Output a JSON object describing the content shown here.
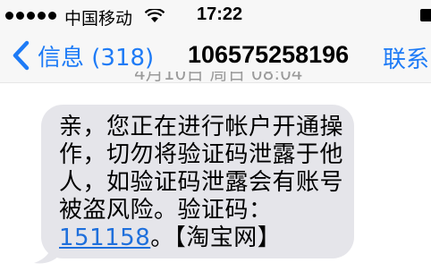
{
  "status_bar": {
    "carrier": "中国移动",
    "time": "17:22",
    "icons": [
      "signal-dots-icon",
      "wifi-icon",
      "battery-icon"
    ]
  },
  "nav": {
    "back_label": "信息 (318)",
    "title": "10657525819​6",
    "contact_label": "联系"
  },
  "timestamp": "4月10日 周日 08:04",
  "message": {
    "line1": "亲，您正在进行帐户开通操",
    "line2": "作，切勿将验证码泄露于他",
    "line3": "人，如验证码泄露会有账号",
    "line4": "被盗风险。验证码：",
    "code": "151158",
    "suffix": "。【淘宝网】"
  },
  "colors": {
    "accent": "#1e7bf6",
    "bubble": "#e5e5ea",
    "link": "#1e6fdc"
  }
}
